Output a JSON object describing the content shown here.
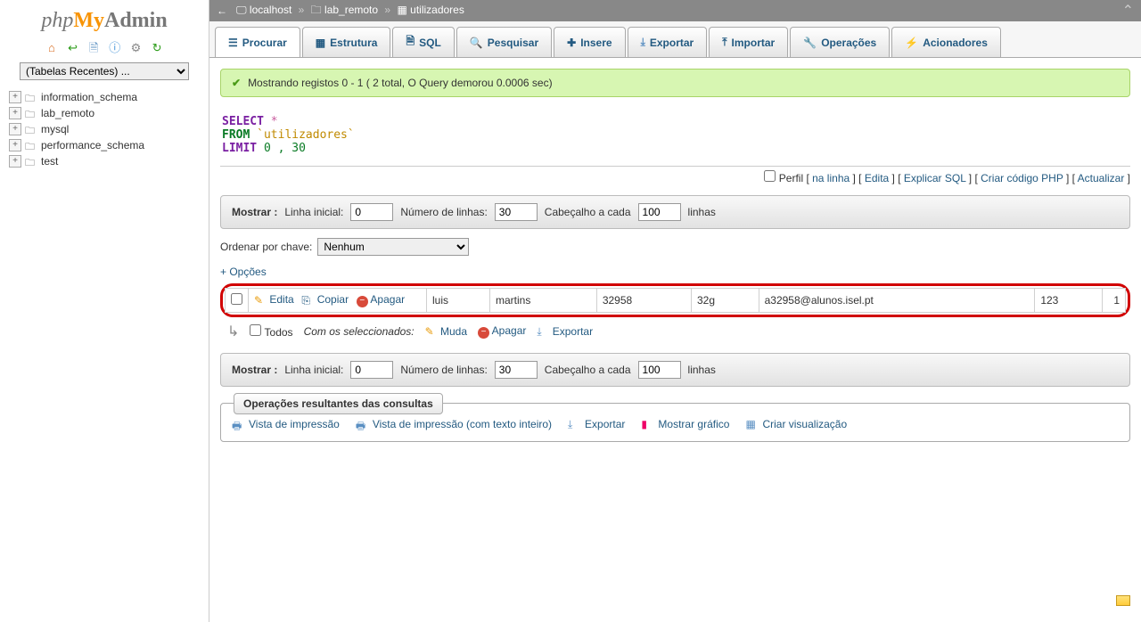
{
  "logo": {
    "p1": "php",
    "p2": "My",
    "p3": "Admin"
  },
  "recent_tables_label": "(Tabelas Recentes) ...",
  "databases": [
    {
      "name": "information_schema"
    },
    {
      "name": "lab_remoto"
    },
    {
      "name": "mysql"
    },
    {
      "name": "performance_schema"
    },
    {
      "name": "test"
    }
  ],
  "breadcrumb": {
    "host": "localhost",
    "db": "lab_remoto",
    "table": "utilizadores"
  },
  "tabs": [
    {
      "label": "Procurar",
      "active": true
    },
    {
      "label": "Estrutura"
    },
    {
      "label": "SQL"
    },
    {
      "label": "Pesquisar"
    },
    {
      "label": "Insere"
    },
    {
      "label": "Exportar"
    },
    {
      "label": "Importar"
    },
    {
      "label": "Operações"
    },
    {
      "label": "Acionadores"
    }
  ],
  "success_msg": "Mostrando registos 0 - 1 ( 2 total, O Query demorou 0.0006 sec)",
  "sql": {
    "select": "SELECT",
    "star": "*",
    "from": "FROM",
    "table": "`utilizadores`",
    "limit": "LIMIT",
    "nums": "0 , 30"
  },
  "links": {
    "perfil": "Perfil",
    "na_linha": "na linha",
    "edita": "Edita",
    "explicar": "Explicar SQL",
    "criar_php": "Criar código PHP",
    "actualizar": "Actualizar"
  },
  "showbar": {
    "mostrar": "Mostrar :",
    "linha_inicial": "Linha inicial:",
    "linha_inicial_val": "0",
    "num_linhas": "Número de linhas:",
    "num_linhas_val": "30",
    "cabecalho": "Cabeçalho a cada",
    "cabecalho_val": "100",
    "linhas": "linhas"
  },
  "sort": {
    "label": "Ordenar por chave:",
    "value": "Nenhum"
  },
  "options": "+ Opções",
  "row_actions": {
    "edita": "Edita",
    "copiar": "Copiar",
    "apagar": "Apagar"
  },
  "row": {
    "c1": "luis",
    "c2": "martins",
    "c3": "32958",
    "c4": "32g",
    "c5": "a32958@alunos.isel.pt",
    "c6": "123",
    "c7": "1"
  },
  "selectrow": {
    "todos": "Todos",
    "com": "Com os seleccionados:",
    "muda": "Muda",
    "apagar": "Apagar",
    "exportar": "Exportar"
  },
  "fieldset": {
    "title": "Operações resultantes das consultas",
    "print": "Vista de impressão",
    "print_full": "Vista de impressão (com texto inteiro)",
    "export": "Exportar",
    "chart": "Mostrar gráfico",
    "view": "Criar visualização"
  }
}
